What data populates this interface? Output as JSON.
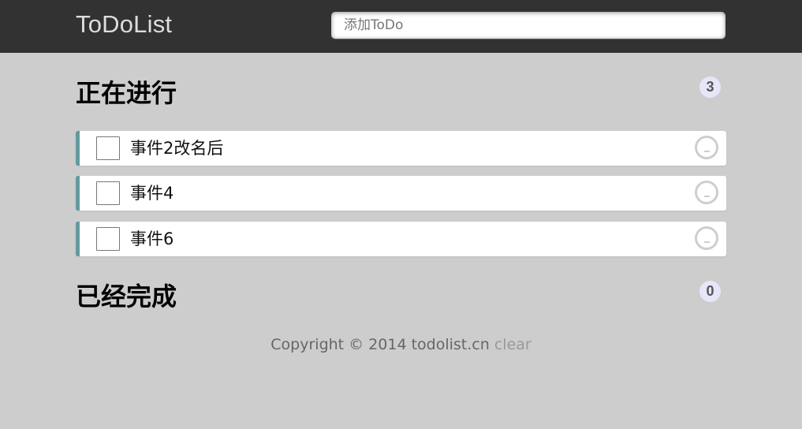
{
  "header": {
    "brand": "ToDoList",
    "add_placeholder": "添加ToDo"
  },
  "doing": {
    "title": "正在进行",
    "count": "3",
    "items": [
      {
        "text": "事件2改名后"
      },
      {
        "text": "事件4"
      },
      {
        "text": "事件6"
      }
    ]
  },
  "done": {
    "title": "已经完成",
    "count": "0",
    "items": []
  },
  "footer": {
    "copyright": "Copyright © 2014 todolist.cn",
    "clear_label": "clear"
  },
  "colors": {
    "header_bg": "#323232",
    "page_bg": "#cdcdcd",
    "item_accent": "#629a9c",
    "badge_bg": "#e6e6fa"
  },
  "icons": {
    "checkbox": "checkbox-icon",
    "delete": "minus-circle-icon"
  }
}
